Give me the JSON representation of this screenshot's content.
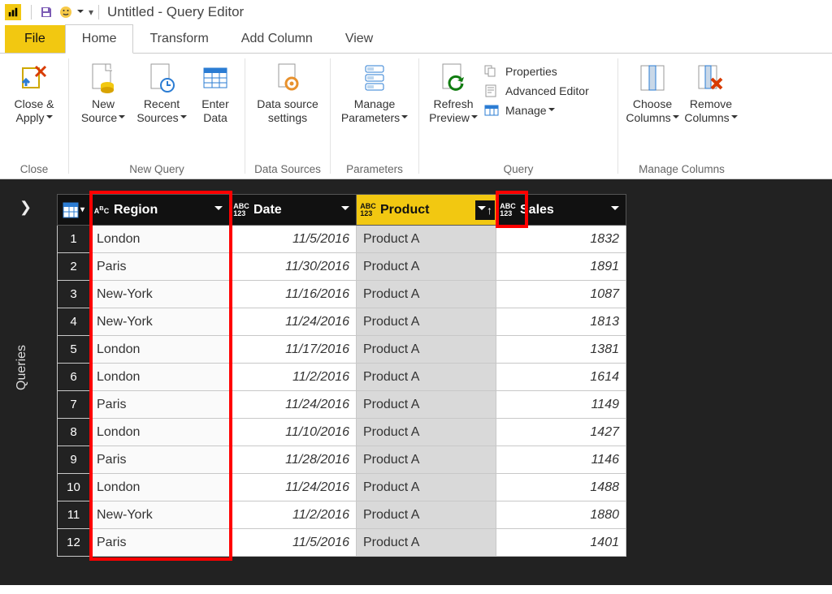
{
  "titlebar": {
    "title": "Untitled - Query Editor"
  },
  "tabs": {
    "file": "File",
    "home": "Home",
    "transform": "Transform",
    "addColumn": "Add Column",
    "view": "View"
  },
  "ribbon": {
    "close": {
      "closeApply": "Close &\nApply",
      "group": "Close"
    },
    "newQuery": {
      "newSource": "New\nSource",
      "recentSources": "Recent\nSources",
      "enterData": "Enter\nData",
      "group": "New Query"
    },
    "dataSources": {
      "settings": "Data source\nsettings",
      "group": "Data Sources"
    },
    "parameters": {
      "manage": "Manage\nParameters",
      "group": "Parameters"
    },
    "query": {
      "refresh": "Refresh\nPreview",
      "properties": "Properties",
      "advanced": "Advanced Editor",
      "manage": "Manage",
      "group": "Query"
    },
    "manageCols": {
      "choose": "Choose\nColumns",
      "remove": "Remove\nColumns",
      "group": "Manage Columns"
    }
  },
  "rail": {
    "label": "Queries"
  },
  "columns": {
    "region": "Region",
    "date": "Date",
    "product": "Product",
    "sales": "Sales"
  },
  "rows": [
    {
      "n": 1,
      "region": "London",
      "date": "11/5/2016",
      "product": "Product A",
      "sales": "1832"
    },
    {
      "n": 2,
      "region": "Paris",
      "date": "11/30/2016",
      "product": "Product A",
      "sales": "1891"
    },
    {
      "n": 3,
      "region": "New-York",
      "date": "11/16/2016",
      "product": "Product A",
      "sales": "1087"
    },
    {
      "n": 4,
      "region": "New-York",
      "date": "11/24/2016",
      "product": "Product A",
      "sales": "1813"
    },
    {
      "n": 5,
      "region": "London",
      "date": "11/17/2016",
      "product": "Product A",
      "sales": "1381"
    },
    {
      "n": 6,
      "region": "London",
      "date": "11/2/2016",
      "product": "Product A",
      "sales": "1614"
    },
    {
      "n": 7,
      "region": "Paris",
      "date": "11/24/2016",
      "product": "Product A",
      "sales": "1149"
    },
    {
      "n": 8,
      "region": "London",
      "date": "11/10/2016",
      "product": "Product A",
      "sales": "1427"
    },
    {
      "n": 9,
      "region": "Paris",
      "date": "11/28/2016",
      "product": "Product A",
      "sales": "1146"
    },
    {
      "n": 10,
      "region": "London",
      "date": "11/24/2016",
      "product": "Product A",
      "sales": "1488"
    },
    {
      "n": 11,
      "region": "New-York",
      "date": "11/2/2016",
      "product": "Product A",
      "sales": "1880"
    },
    {
      "n": 12,
      "region": "Paris",
      "date": "11/5/2016",
      "product": "Product A",
      "sales": "1401"
    }
  ]
}
